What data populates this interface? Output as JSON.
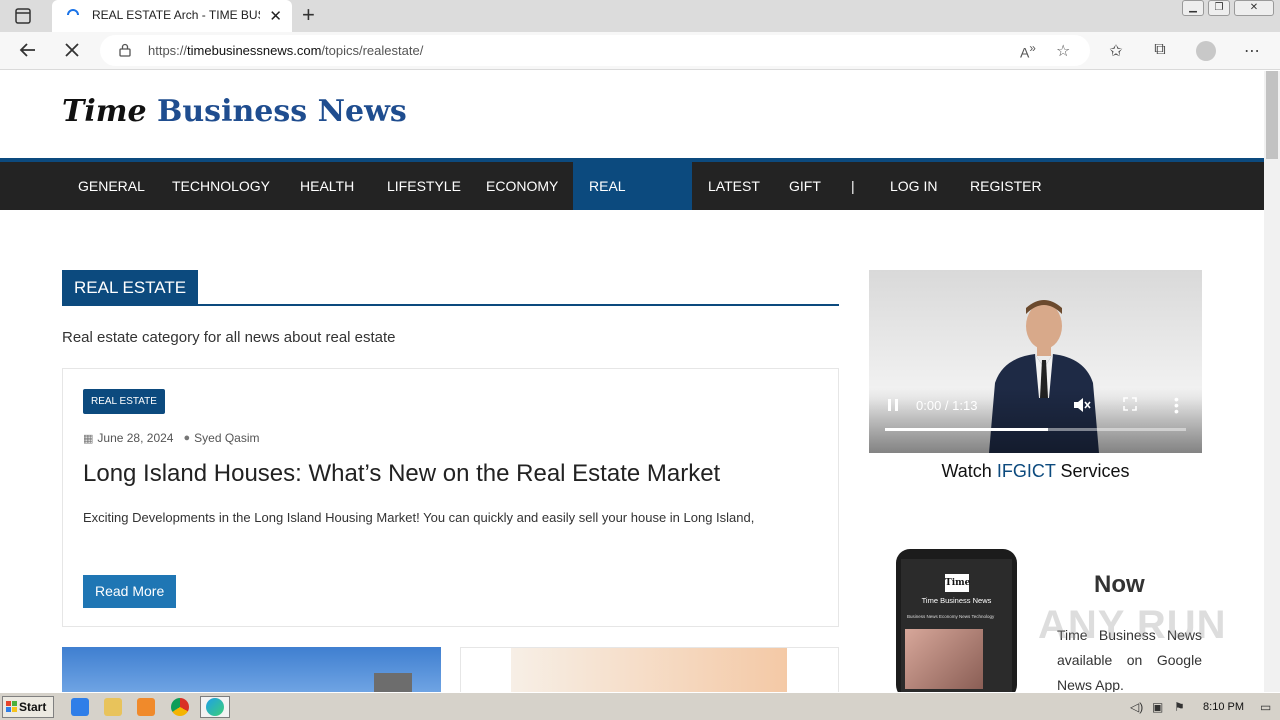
{
  "browser": {
    "tab_title": "REAL ESTATE Arch - TIME BUSINESS NEWS",
    "url_scheme": "https://",
    "url_host": "timebusinessnews.com",
    "url_path": "/topics/realestate/"
  },
  "site": {
    "logo_word1": "Time",
    "logo_word2": "Business News"
  },
  "nav": {
    "items": [
      {
        "label": "GENERAL"
      },
      {
        "label": "TECHNOLOGY"
      },
      {
        "label": "HEALTH"
      },
      {
        "label": "LIFESTYLE"
      },
      {
        "label": "ECONOMY"
      },
      {
        "label": "REAL ESTATE",
        "active": true
      },
      {
        "label": "LATEST"
      },
      {
        "label": "GIFT"
      },
      {
        "label": "|"
      },
      {
        "label": "LOG IN"
      },
      {
        "label": "REGISTER"
      }
    ]
  },
  "category": {
    "title": "REAL ESTATE",
    "description": "Real estate category for all news about real estate"
  },
  "post": {
    "badge": "REAL ESTATE",
    "date": "June 28, 2024",
    "author": "Syed Qasim",
    "title": "Long Island Houses: What’s New on the Real Estate Market",
    "excerpt": "Exciting Developments in the Long Island Housing Market!   You can quickly and easily sell your house in Long Island,",
    "read_more": "Read More"
  },
  "sidebar": {
    "video_time": "0:00 / 1:13",
    "video_progress": 0.54,
    "watch_prefix": "Watch ",
    "watch_highlight": "IFGICT",
    "watch_suffix": " Services",
    "phone_logo": "Time",
    "phone_brand": "Time Business News",
    "phone_tabs": "Business News    Economy News    Technology",
    "app_now": "Now",
    "app_text": "Time Business News available on Google News App."
  },
  "watermark": "ANY RUN",
  "taskbar": {
    "start_label": "Start",
    "clock": "8:10 PM"
  },
  "colors": {
    "brand": "#0c4a7e",
    "nav_bg": "#232323",
    "read_more": "#1f76b4"
  }
}
